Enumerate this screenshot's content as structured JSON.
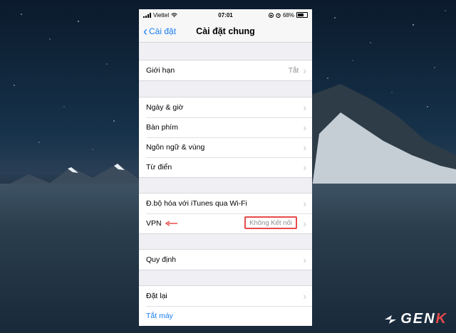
{
  "status_bar": {
    "carrier": "Viettel",
    "time": "07:01",
    "battery": "68%",
    "battery_level": 0.68
  },
  "nav": {
    "back_label": "Cài đặt",
    "title": "Cài đặt chung"
  },
  "groups": [
    {
      "rows": [
        {
          "label": "Giới hạn",
          "value": "Tắt"
        }
      ]
    },
    {
      "rows": [
        {
          "label": "Ngày & giờ"
        },
        {
          "label": "Bàn phím"
        },
        {
          "label": "Ngôn ngữ & vùng"
        },
        {
          "label": "Từ điển"
        }
      ]
    },
    {
      "rows": [
        {
          "label": "Đ.bộ hóa với iTunes qua Wi-Fi"
        },
        {
          "label": "VPN",
          "value": "Không Kết nối"
        }
      ]
    },
    {
      "rows": [
        {
          "label": "Quy định"
        }
      ]
    },
    {
      "rows": [
        {
          "label": "Đặt lại"
        },
        {
          "label": "Tắt máy"
        }
      ]
    }
  ],
  "watermark": {
    "text_a": "GEN",
    "text_b": "K"
  },
  "colors": {
    "ios_blue": "#1a7cf0",
    "highlight_red": "#e84a4a"
  }
}
